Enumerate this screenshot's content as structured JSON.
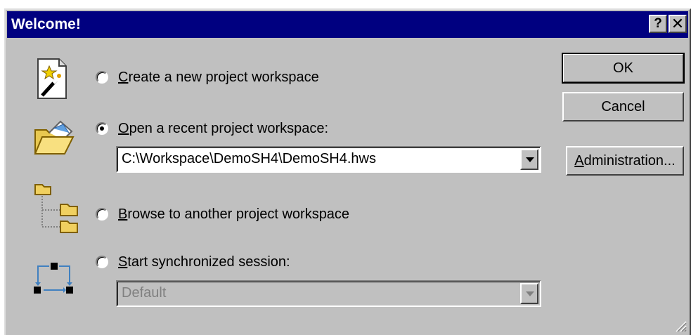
{
  "window": {
    "title": "Welcome!",
    "help_label": "?",
    "close_label": "✕"
  },
  "options": [
    {
      "icon": "new-project-wizard-icon",
      "label_key": "C",
      "label_rest": "reate a new project workspace",
      "checked": false
    },
    {
      "icon": "open-folder-icon",
      "label_key": "O",
      "label_rest": "pen a recent project workspace:",
      "checked": true
    },
    {
      "icon": "folder-tree-icon",
      "label_key": "B",
      "label_rest": "rowse to another project workspace",
      "checked": false
    },
    {
      "icon": "synchronized-session-icon",
      "label_key": "S",
      "label_rest": "tart synchronized session:",
      "checked": false
    }
  ],
  "recent_workspace": {
    "value": "C:\\Workspace\\DemoSH4\\DemoSH4.hws"
  },
  "sync_session": {
    "value": "Default",
    "enabled": false
  },
  "buttons": {
    "ok": "OK",
    "cancel": "Cancel",
    "admin_key": "A",
    "admin_rest": "dministration..."
  }
}
